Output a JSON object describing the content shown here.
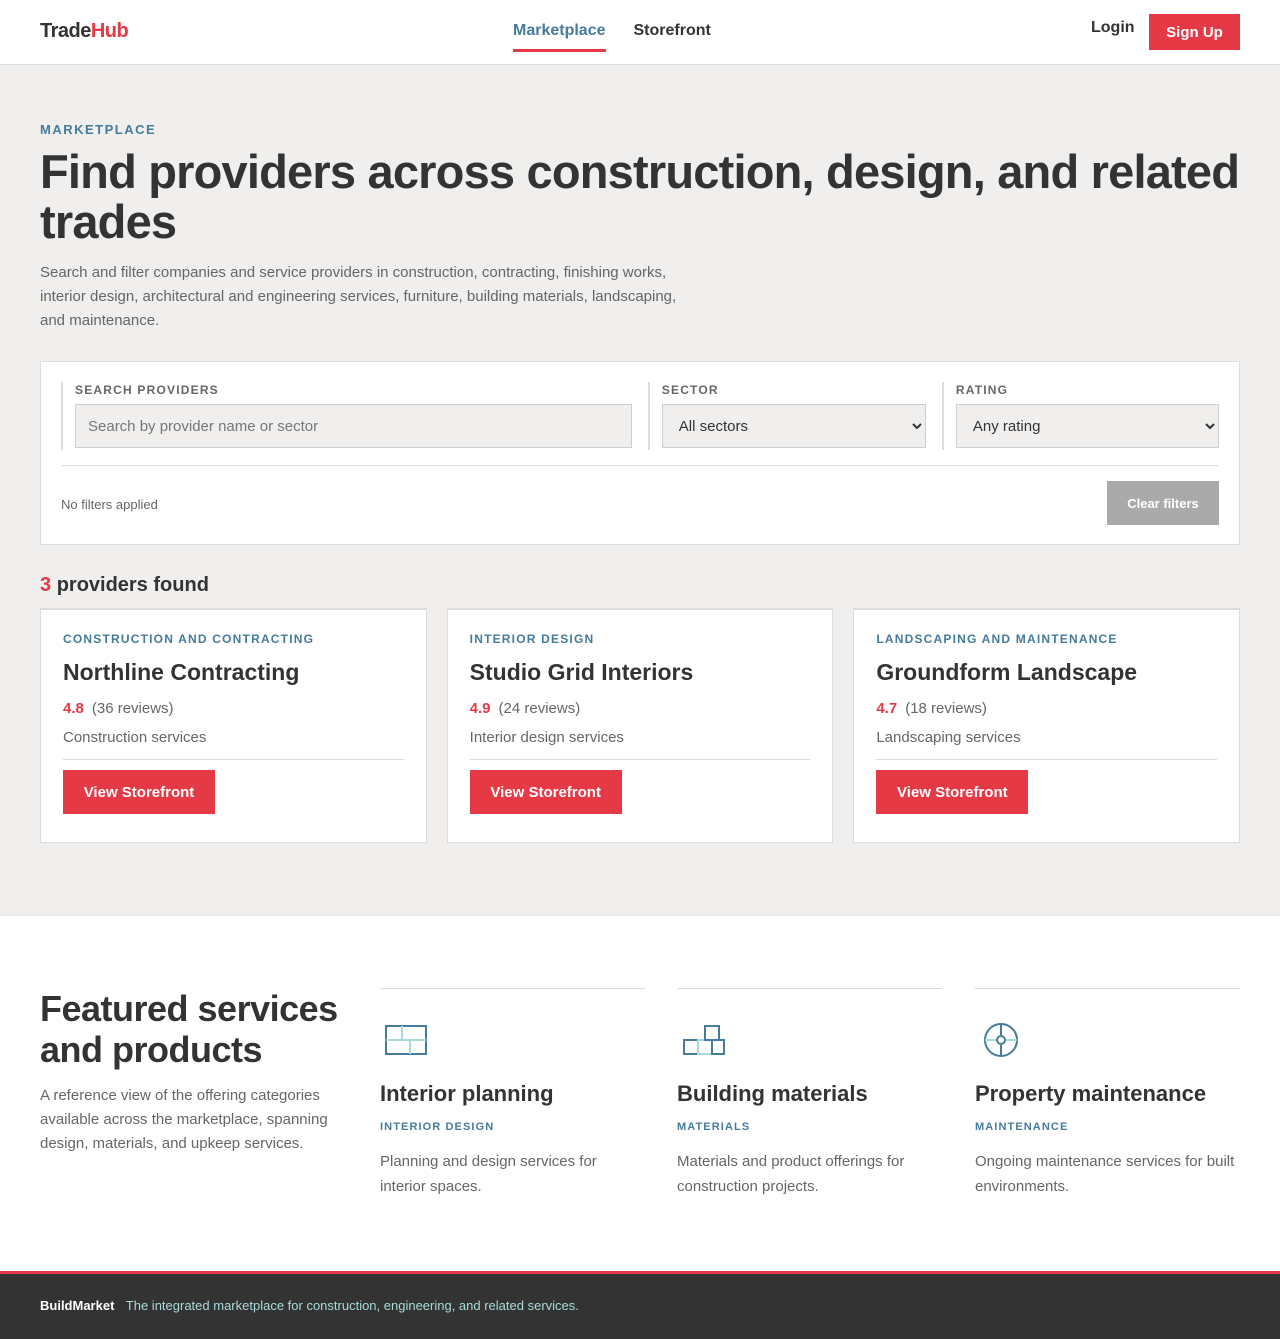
{
  "header": {
    "logo_part1": "Trade",
    "logo_part2": "Hub",
    "nav": [
      {
        "label": "Marketplace",
        "active": true
      },
      {
        "label": "Storefront",
        "active": false
      }
    ],
    "login_label": "Login",
    "signup_label": "Sign Up"
  },
  "hero": {
    "eyebrow": "MARKETPLACE",
    "title": "Find providers across construction, design, and related trades",
    "description": "Search and filter companies and service providers in construction, contracting, finishing works, interior design, architectural and engineering services, furniture, building materials, landscaping, and maintenance."
  },
  "filters": {
    "search_label": "SEARCH PROVIDERS",
    "search_placeholder": "Search by provider name or sector",
    "search_value": "",
    "sector_label": "SECTOR",
    "sector_selected": "All sectors",
    "rating_label": "RATING",
    "rating_selected": "Any rating",
    "status": "No filters applied",
    "clear_label": "Clear filters"
  },
  "results": {
    "count": "3",
    "count_label": "providers found",
    "cards": [
      {
        "category": "CONSTRUCTION AND CONTRACTING",
        "name": "Northline Contracting",
        "rating": "4.8",
        "reviews": "(36 reviews)",
        "service": "Construction services",
        "button": "View Storefront"
      },
      {
        "category": "INTERIOR DESIGN",
        "name": "Studio Grid Interiors",
        "rating": "4.9",
        "reviews": "(24 reviews)",
        "service": "Interior design services",
        "button": "View Storefront"
      },
      {
        "category": "LANDSCAPING AND MAINTENANCE",
        "name": "Groundform Landscape",
        "rating": "4.7",
        "reviews": "(18 reviews)",
        "service": "Landscaping services",
        "button": "View Storefront"
      }
    ]
  },
  "featured": {
    "title": "Featured services and products",
    "description": "A reference view of the offering categories available across the marketplace, spanning design, materials, and upkeep services.",
    "items": [
      {
        "icon": "floorplan-icon",
        "name": "Interior planning",
        "tag": "INTERIOR DESIGN",
        "description": "Planning and design services for interior spaces."
      },
      {
        "icon": "stacked-boxes-icon",
        "name": "Building materials",
        "tag": "MATERIALS",
        "description": "Materials and product offerings for construction projects."
      },
      {
        "icon": "crosshair-icon",
        "name": "Property maintenance",
        "tag": "MAINTENANCE",
        "description": "Ongoing maintenance services for built environments."
      }
    ]
  },
  "footer": {
    "brand": "BuildMarket",
    "tagline": "The integrated marketplace for construction, engineering, and related services."
  },
  "colors": {
    "accent_red": "#e63946",
    "accent_blue": "#457b9d",
    "text_dark": "#333333",
    "background": "#f0efed",
    "footer_tagline": "#a8dadc"
  }
}
